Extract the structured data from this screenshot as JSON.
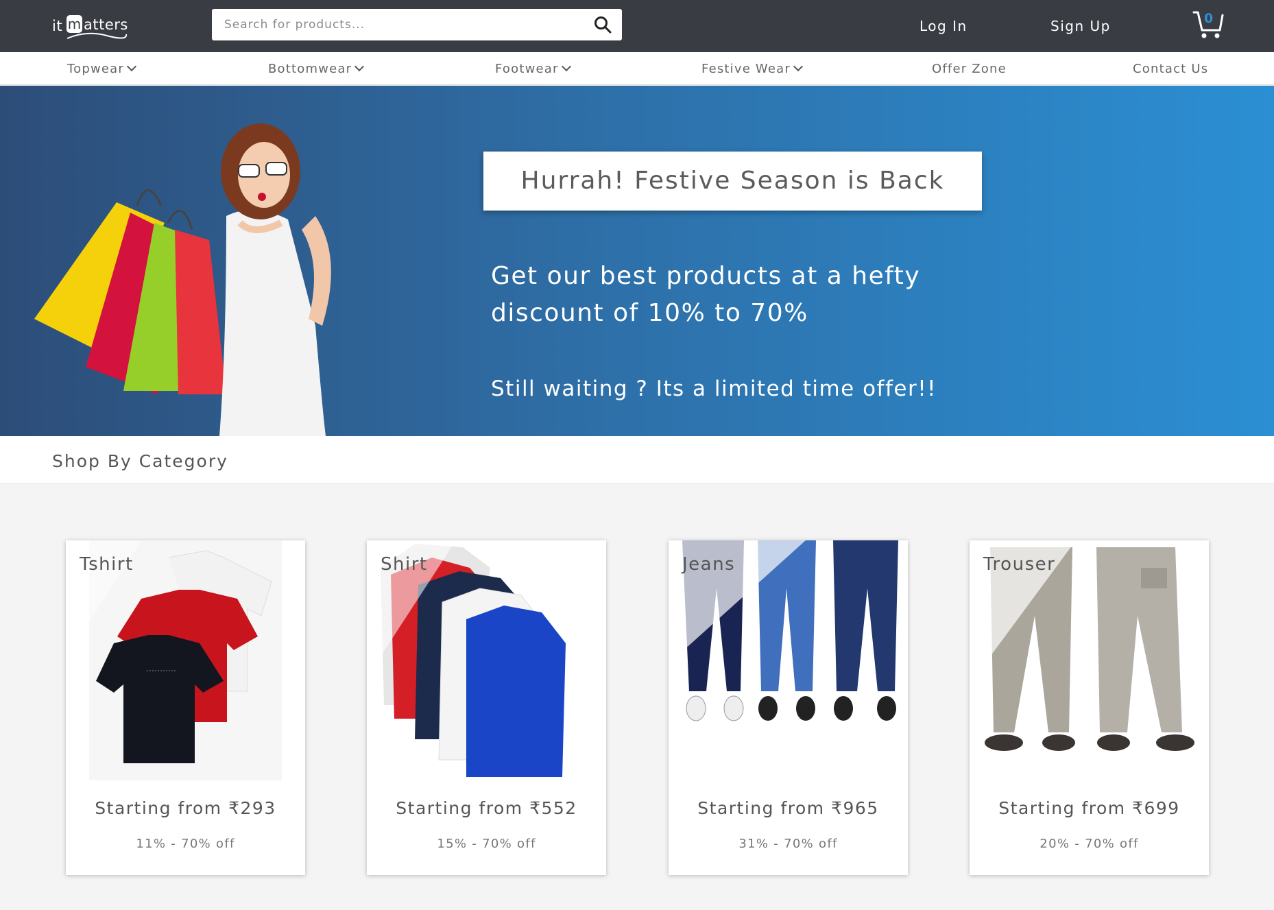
{
  "header": {
    "logo": {
      "it": "it",
      "m": "m",
      "rest": "atters"
    },
    "search_placeholder": "Search for products...",
    "login": "Log In",
    "signup": "Sign Up",
    "cart_count": "0",
    "colors": {
      "header_bg": "#393c43",
      "accent": "#2e8fd6"
    }
  },
  "nav": {
    "items": [
      {
        "label": "Topwear"
      },
      {
        "label": "Bottomwear"
      },
      {
        "label": "Footwear"
      },
      {
        "label": "Festive Wear"
      },
      {
        "label": "Offer Zone"
      },
      {
        "label": "Contact Us"
      }
    ]
  },
  "hero": {
    "title": "Hurrah!  Festive Season is Back",
    "line1": "Get our best products at a hefty",
    "line2": "discount of 10% to 70%",
    "line3": "Still waiting ? Its a limited time offer!!"
  },
  "section": {
    "title": "Shop By Category"
  },
  "categories": [
    {
      "name": "Tshirt",
      "price": "Starting from ₹293",
      "discount": "11% - 70% off"
    },
    {
      "name": "Shirt",
      "price": "Starting from ₹552",
      "discount": "15% - 70% off"
    },
    {
      "name": "Jeans",
      "price": "Starting from ₹965",
      "discount": "31% - 70% off"
    },
    {
      "name": "Trouser",
      "price": "Starting from ₹699",
      "discount": "20% - 70% off"
    }
  ]
}
